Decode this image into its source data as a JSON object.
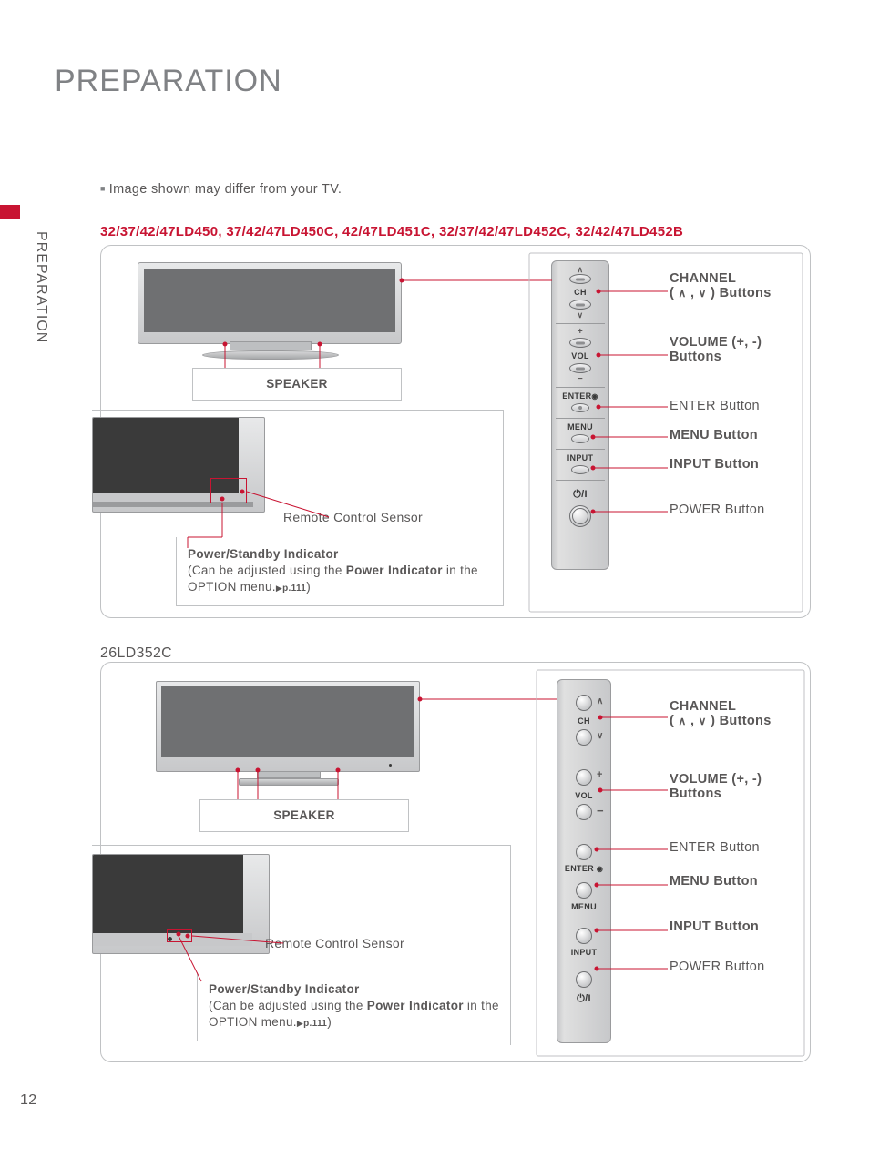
{
  "page": {
    "title": "PREPARATION",
    "sidebar": "PREPARATION",
    "page_number": "12",
    "note": "Image shown may differ from your TV."
  },
  "section1": {
    "model_heading": "32/37/42/47LD450, 37/42/47LD450C, 42/47LD451C, 32/37/42/47LD452C, 32/42/47LD452B",
    "speaker_label": "SPEAKER",
    "sensor_label": "Remote Control Sensor",
    "psi_title": "Power/Standby Indicator",
    "psi_line1": "(Can be adjusted using the ",
    "psi_bold": "Power Indicator",
    "psi_line2": " in the OPTION menu.",
    "psi_pref": "p.111",
    "psi_close": ")",
    "panel": {
      "ch": "CH",
      "vol": "VOL",
      "enter": "ENTER",
      "menu": "MENU",
      "input": "INPUT",
      "power": "⏻/I"
    },
    "callouts": {
      "channel_title": "CHANNEL",
      "channel_sub": "(    ,    ) Buttons",
      "volume_title": "VOLUME (+, -)",
      "volume_sub": "Buttons",
      "enter": "ENTER Button",
      "menu": "MENU Button",
      "input": "INPUT Button",
      "power": "POWER Button"
    }
  },
  "section2": {
    "model_heading": "26LD352C",
    "speaker_label": "SPEAKER",
    "sensor_label": "Remote Control Sensor",
    "psi_title": "Power/Standby Indicator",
    "psi_line1": "(Can be adjusted using the ",
    "psi_bold": "Power Indicator",
    "psi_line2": " in the OPTION menu.",
    "psi_pref": "p.111",
    "psi_close": ")",
    "panel": {
      "ch": "CH",
      "vol": "VOL",
      "enter": "ENTER",
      "menu": "MENU",
      "input": "INPUT",
      "power": "⏻/I"
    },
    "callouts": {
      "channel_title": "CHANNEL",
      "channel_sub": "(    ,    ) Buttons",
      "volume_title": "VOLUME (+, -)",
      "volume_sub": "Buttons",
      "enter": "ENTER Button",
      "menu": "MENU Button",
      "input": "INPUT Button",
      "power": "POWER Button"
    }
  }
}
